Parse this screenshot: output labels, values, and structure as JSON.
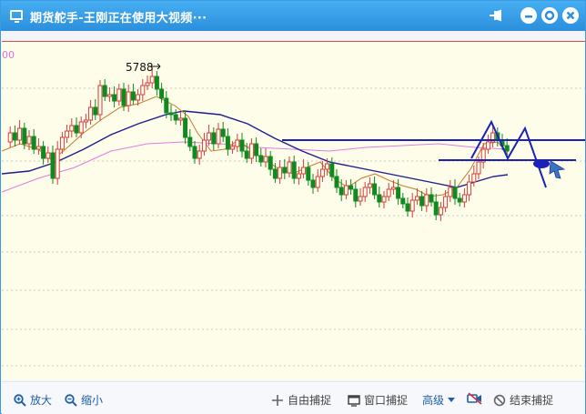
{
  "window": {
    "title": "期货舵手-王刚正在使用大视频···"
  },
  "titlebar_buttons": {
    "pin": "pin-icon",
    "minimize": "minimize-icon",
    "maximize": "settings-circle-icon",
    "close": "close-icon"
  },
  "chart": {
    "price_label": "5788",
    "axis_partial_label": "00"
  },
  "toolbar": {
    "zoom_in_label": "放大",
    "zoom_out_label": "缩小",
    "free_capture_label": "自由捕捉",
    "window_capture_label": "窗口捕捉",
    "advanced_label": "高级",
    "end_capture_label": "结束捕捉"
  },
  "colors": {
    "titlebar": "#2b8fdc",
    "chart_bg": "#fefde9",
    "candle_up": "#d63c3c",
    "candle_down": "#0e8a1e",
    "ma_dark": "#1d1d8f",
    "ma_pink": "#e07ce0",
    "ma_orange": "#c87a2a",
    "drawing": "#1c22b8",
    "link": "#1f5fa8"
  }
}
